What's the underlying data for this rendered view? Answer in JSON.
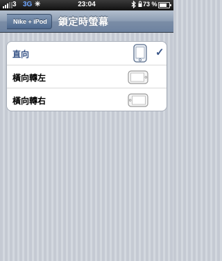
{
  "status_bar": {
    "carrier": "3",
    "network": "3G",
    "time": "23:04",
    "battery_percent": "73 %"
  },
  "nav": {
    "back_label": "Nike + iPod",
    "title": "鎖定時螢幕"
  },
  "options": [
    {
      "label": "直向",
      "icon": "portrait-device-icon",
      "selected": true
    },
    {
      "label": "橫向轉左",
      "icon": "landscape-left-device-icon",
      "selected": false
    },
    {
      "label": "橫向轉右",
      "icon": "landscape-right-device-icon",
      "selected": false
    }
  ],
  "colors": {
    "accent": "#385487",
    "nav_bar": "#7b8da6"
  }
}
